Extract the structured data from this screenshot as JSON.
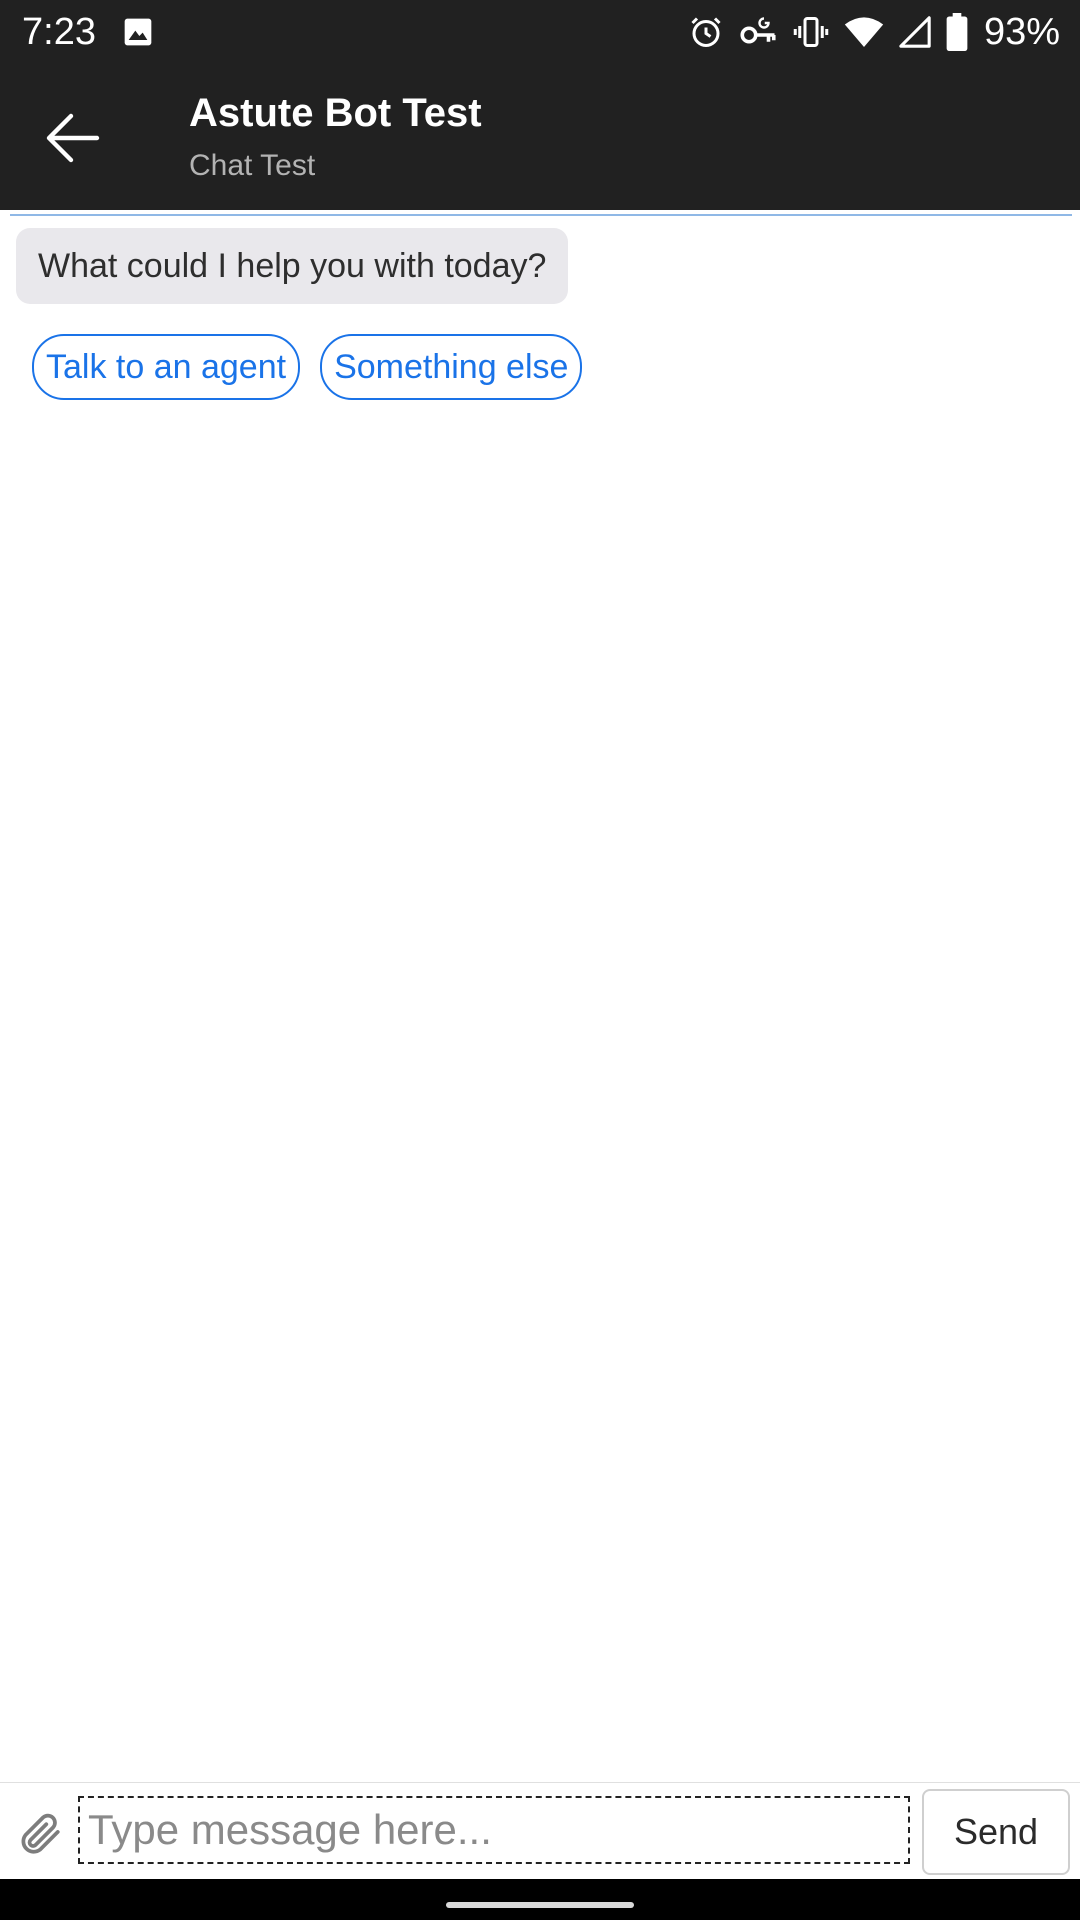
{
  "status_bar": {
    "time": "7:23",
    "battery_percent": "93%",
    "icons": [
      "photo-icon",
      "alarm-icon",
      "vpn-key-icon",
      "vibrate-icon",
      "wifi-icon",
      "cell-signal-icon",
      "battery-icon"
    ]
  },
  "header": {
    "title": "Astute Bot Test",
    "subtitle": "Chat Test",
    "back_icon": "arrow-left-icon",
    "background_color": "#212121",
    "accent_line_color": "#8fb8e6"
  },
  "messages": [
    {
      "sender": "bot",
      "text": "What could I help you with today?"
    }
  ],
  "quick_replies": [
    {
      "label": "Talk to an agent"
    },
    {
      "label": "Something else"
    }
  ],
  "quick_reply_color": "#1a73e8",
  "composer": {
    "attach_icon": "paperclip-icon",
    "placeholder": "Type message here...",
    "value": "",
    "send_label": "Send"
  }
}
